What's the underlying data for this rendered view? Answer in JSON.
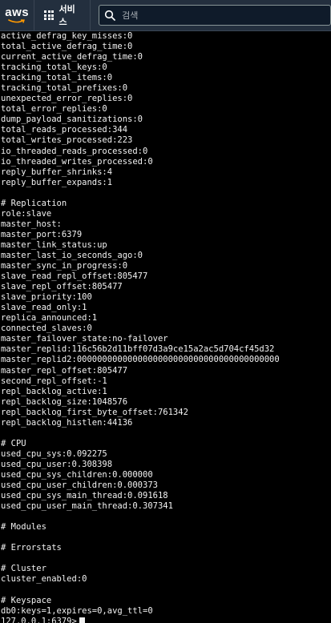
{
  "header": {
    "logo_text": "aws",
    "services_label": "서비스",
    "search_placeholder": "검색"
  },
  "terminal": {
    "lines": [
      "active_defrag_key_misses:0",
      "total_active_defrag_time:0",
      "current_active_defrag_time:0",
      "tracking_total_keys:0",
      "tracking_total_items:0",
      "tracking_total_prefixes:0",
      "unexpected_error_replies:0",
      "total_error_replies:0",
      "dump_payload_sanitizations:0",
      "total_reads_processed:344",
      "total_writes_processed:223",
      "io_threaded_reads_processed:0",
      "io_threaded_writes_processed:0",
      "reply_buffer_shrinks:4",
      "reply_buffer_expands:1",
      "",
      "# Replication",
      "role:slave",
      "master_host:",
      "master_port:6379",
      "master_link_status:up",
      "master_last_io_seconds_ago:0",
      "master_sync_in_progress:0",
      "slave_read_repl_offset:805477",
      "slave_repl_offset:805477",
      "slave_priority:100",
      "slave_read_only:1",
      "replica_announced:1",
      "connected_slaves:0",
      "master_failover_state:no-failover",
      "master_replid:116c56b2d11bff07d3a9ce15a2ac5d704cf45d32",
      "master_replid2:0000000000000000000000000000000000000000",
      "master_repl_offset:805477",
      "second_repl_offset:-1",
      "repl_backlog_active:1",
      "repl_backlog_size:1048576",
      "repl_backlog_first_byte_offset:761342",
      "repl_backlog_histlen:44136",
      "",
      "# CPU",
      "used_cpu_sys:0.092275",
      "used_cpu_user:0.308398",
      "used_cpu_sys_children:0.000000",
      "used_cpu_user_children:0.000373",
      "used_cpu_sys_main_thread:0.091618",
      "used_cpu_user_main_thread:0.307341",
      "",
      "# Modules",
      "",
      "# Errorstats",
      "",
      "# Cluster",
      "cluster_enabled:0",
      "",
      "# Keyspace",
      "db0:keys=1,expires=0,avg_ttl=0"
    ],
    "prompt": "127.0.0.1:6379>"
  }
}
